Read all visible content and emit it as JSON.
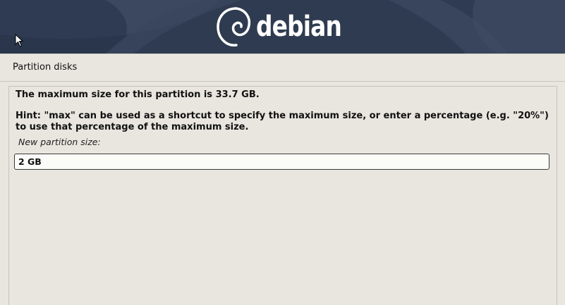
{
  "banner": {
    "logo_text": "debian",
    "logo_icon": "debian-swirl-icon"
  },
  "section": {
    "title": "Partition disks"
  },
  "dialog": {
    "max_size_message": "The maximum size for this partition is 33.7 GB.",
    "hint_message": "Hint: \"max\" can be used as a shortcut to specify the maximum size, or enter a percentage (e.g. \"20%\") to use that percentage of the maximum size.",
    "field_label": "New partition size:",
    "field_value": "2 GB"
  },
  "colors": {
    "banner_background": "#2e3a4f",
    "page_background": "#e8e6df",
    "input_background": "#fbfbf8"
  }
}
